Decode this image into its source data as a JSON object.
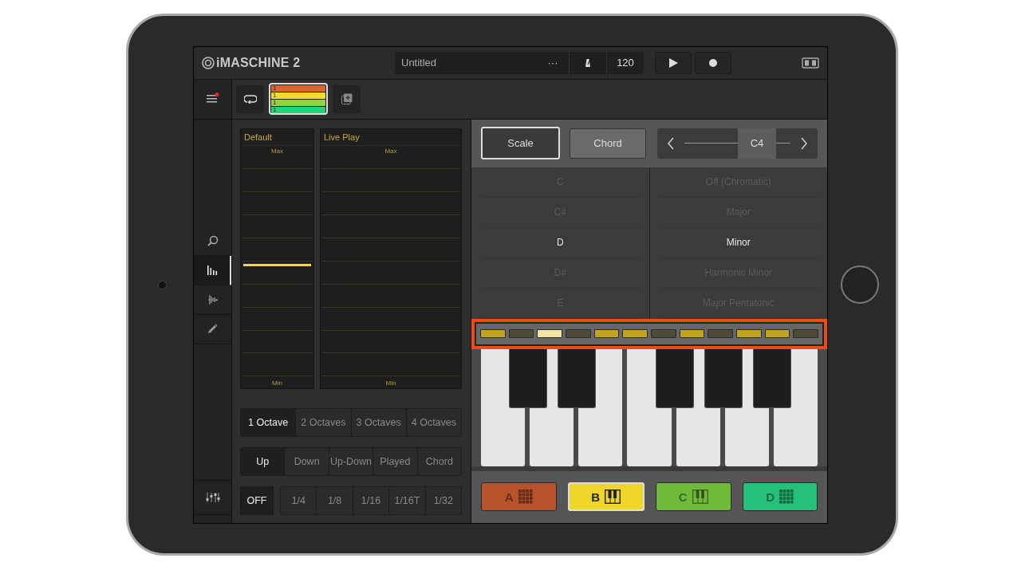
{
  "header": {
    "logo": "iMASCHINE 2",
    "project_title": "Untitled",
    "more": "···",
    "tempo": "120"
  },
  "sidebar": {
    "items": [
      {
        "kind": "search",
        "selected": false
      },
      {
        "kind": "bars",
        "selected": true
      },
      {
        "kind": "wave",
        "selected": false
      },
      {
        "kind": "pencil",
        "selected": false
      }
    ]
  },
  "pattern_bank": [
    {
      "label": "1",
      "color": "#d9662e"
    },
    {
      "label": "1",
      "color": "#f2dc2a"
    },
    {
      "label": "1",
      "color": "#8ed63e"
    },
    {
      "label": "1",
      "color": "#2ecf7a"
    }
  ],
  "strips": [
    {
      "title": "Default",
      "max": "Max",
      "min": "Min",
      "level": 0.51
    },
    {
      "title": "Live Play",
      "max": "Max",
      "min": "Min"
    }
  ],
  "octaves": [
    {
      "label": "1 Octave",
      "selected": true
    },
    {
      "label": "2 Octaves",
      "selected": false
    },
    {
      "label": "3 Octaves",
      "selected": false
    },
    {
      "label": "4 Octaves",
      "selected": false
    }
  ],
  "directions": [
    {
      "label": "Up",
      "selected": true
    },
    {
      "label": "Down",
      "selected": false
    },
    {
      "label": "Up-Down",
      "selected": false
    },
    {
      "label": "Played",
      "selected": false
    },
    {
      "label": "Chord",
      "selected": false
    }
  ],
  "arp_off": {
    "label": "OFF",
    "selected": true
  },
  "rates": [
    {
      "label": "1/4",
      "selected": false
    },
    {
      "label": "1/8",
      "selected": false
    },
    {
      "label": "1/16",
      "selected": false
    },
    {
      "label": "1/16T",
      "selected": false
    },
    {
      "label": "1/32",
      "selected": false
    }
  ],
  "modes": [
    {
      "label": "Scale",
      "selected": true
    },
    {
      "label": "Chord",
      "selected": false
    }
  ],
  "base_note": "C4",
  "root_notes": [
    {
      "label": "C",
      "selected": false
    },
    {
      "label": "C#",
      "selected": false
    },
    {
      "label": "D",
      "selected": true
    },
    {
      "label": "D#",
      "selected": false
    },
    {
      "label": "E",
      "selected": false
    }
  ],
  "scales": [
    {
      "label": "Off (Chromatic)",
      "selected": false
    },
    {
      "label": "Major",
      "selected": false
    },
    {
      "label": "Minor",
      "selected": true
    },
    {
      "label": "Harmonic Minor",
      "selected": false
    },
    {
      "label": "Major Pentatonic",
      "selected": false
    }
  ],
  "note_indicators": [
    {
      "in_scale": true,
      "selected": false
    },
    {
      "in_scale": false,
      "selected": false
    },
    {
      "in_scale": true,
      "selected": true
    },
    {
      "in_scale": false,
      "selected": false
    },
    {
      "in_scale": true,
      "selected": false
    },
    {
      "in_scale": true,
      "selected": false
    },
    {
      "in_scale": false,
      "selected": false
    },
    {
      "in_scale": true,
      "selected": false
    },
    {
      "in_scale": false,
      "selected": false
    },
    {
      "in_scale": true,
      "selected": false
    },
    {
      "in_scale": true,
      "selected": false
    },
    {
      "in_scale": false,
      "selected": false
    }
  ],
  "pads": [
    {
      "label": "A",
      "kind": "grid",
      "color": "#b8522a",
      "selected": false
    },
    {
      "label": "B",
      "kind": "keys",
      "color": "#efd62a",
      "selected": true
    },
    {
      "label": "C",
      "kind": "keys",
      "color": "#6fba3a",
      "selected": false
    },
    {
      "label": "D",
      "kind": "grid",
      "color": "#27c07a",
      "selected": false
    }
  ]
}
